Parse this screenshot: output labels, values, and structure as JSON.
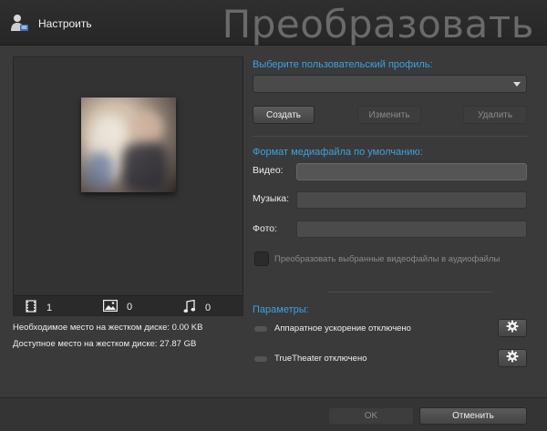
{
  "header": {
    "app_label": "Настроить",
    "big_title": "Преобразовать"
  },
  "preview": {
    "video_count": "1",
    "image_count": "0",
    "music_count": "0"
  },
  "disk": {
    "required": "Необходимое место на жестком диске: 0.00 KB",
    "available": "Доступное место на жестком диске: 27.87 GB"
  },
  "profile": {
    "title": "Выберите пользовательский профиль:",
    "selected": "",
    "create_label": "Создать",
    "edit_label": "Изменить",
    "delete_label": "Удалить"
  },
  "format": {
    "title": "Формат медиафайла по умолчанию:",
    "video_label": "Видео:",
    "music_label": "Музыка:",
    "photo_label": "Фото:",
    "video_value": "",
    "music_value": "",
    "photo_value": "",
    "convert_audio_label": "Преобразовать выбранные видеофайлы в аудиофайлы"
  },
  "params": {
    "title": "Параметры:",
    "hw_accel_label": "Аппаратное ускорение отключено",
    "truetheater_label": "TrueTheater отключено"
  },
  "footer": {
    "ok_label": "OK",
    "cancel_label": "Отменить"
  },
  "colors": {
    "accent": "#3ea1e3",
    "background": "#3a3a3a"
  }
}
